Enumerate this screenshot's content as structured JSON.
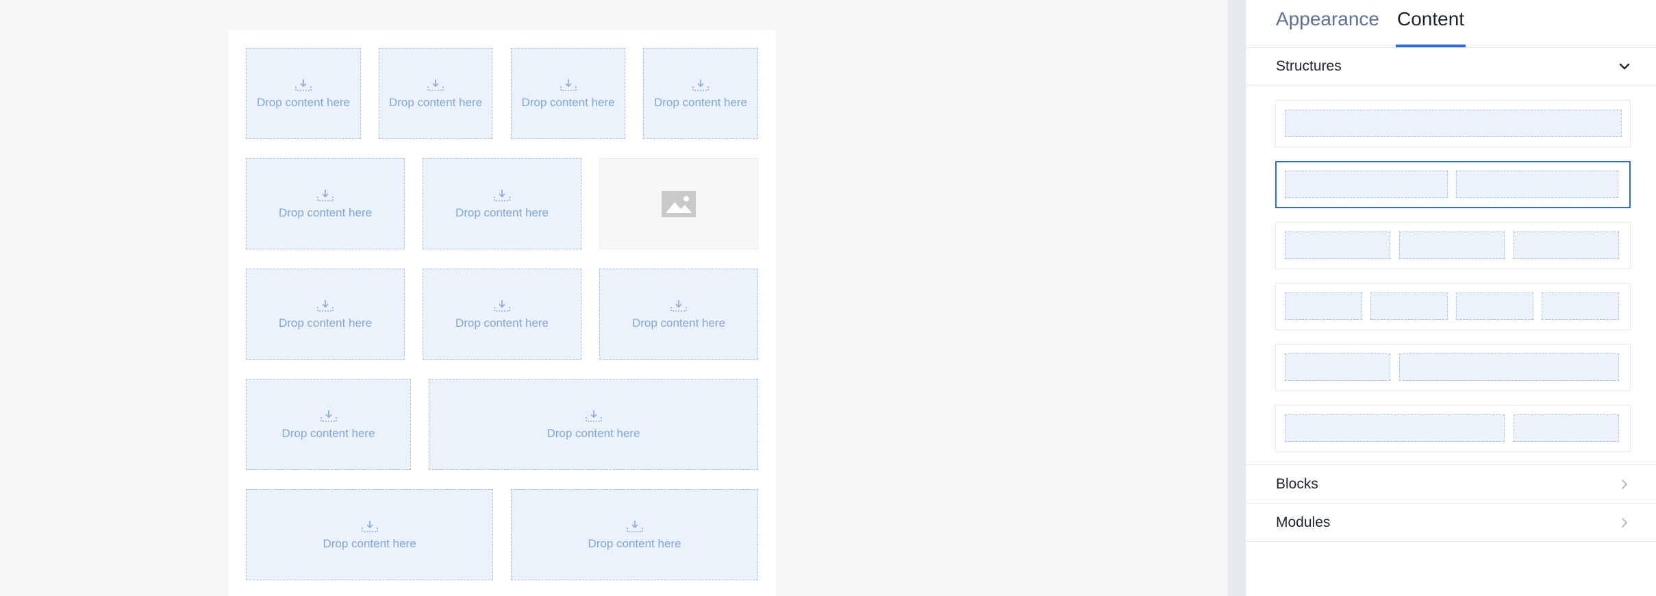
{
  "canvas": {
    "drop_label": "Drop content here",
    "rows": [
      {
        "cells": [
          {
            "type": "drop"
          },
          {
            "type": "drop"
          },
          {
            "type": "drop"
          },
          {
            "type": "drop"
          }
        ]
      },
      {
        "cells": [
          {
            "type": "drop"
          },
          {
            "type": "drop"
          },
          {
            "type": "image"
          }
        ]
      },
      {
        "cells": [
          {
            "type": "drop"
          },
          {
            "type": "drop"
          },
          {
            "type": "drop"
          }
        ]
      },
      {
        "cells": [
          {
            "type": "drop"
          },
          {
            "type": "drop"
          }
        ]
      },
      {
        "cells": [
          {
            "type": "drop"
          },
          {
            "type": "drop"
          }
        ]
      }
    ]
  },
  "sidebar": {
    "tabs": [
      {
        "label": "Appearance",
        "active": false
      },
      {
        "label": "Content",
        "active": true
      }
    ],
    "sections": {
      "structures": {
        "label": "Structures",
        "expanded": true,
        "icon": "chevron-down-icon"
      },
      "blocks": {
        "label": "Blocks",
        "expanded": false,
        "icon": "chevron-right-icon"
      },
      "modules": {
        "label": "Modules",
        "expanded": false,
        "icon": "chevron-right-icon"
      }
    },
    "structures": [
      {
        "columns": "1"
      },
      {
        "columns": "1:1",
        "selected": true
      },
      {
        "columns": "1:1:1"
      },
      {
        "columns": "1:1:1:1"
      },
      {
        "columns": "1:2"
      },
      {
        "columns": "2:1"
      }
    ]
  },
  "colors": {
    "accent": "#2a6ad9",
    "dropzone_fill": "#ebf2fb",
    "dropzone_border": "#a6c2e8",
    "dropzone_text": "#7fa6dc"
  }
}
